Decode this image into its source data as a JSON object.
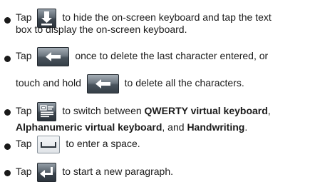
{
  "items": [
    {
      "lines": [
        {
          "pre": "Tap",
          "post": "to hide the on-screen keyboard and tap the text"
        },
        {
          "text": "box to display the on-screen keyboard."
        }
      ],
      "icon": "keyboard-hide-icon"
    },
    {
      "lines": [
        {
          "pre": "Tap",
          "post": "once to delete the last character entered, or"
        },
        {
          "pre": "touch and hold",
          "post": "to delete all the characters."
        }
      ],
      "icon": "backspace-icon"
    },
    {
      "pre": "Tap",
      "post": "to switch between",
      "b1": "QWERTY virtual keyboard",
      "sep1": ",",
      "b2": "Alphanumeric virtual keyboard",
      "sep2": ", and",
      "b3": "Handwriting",
      "end": ".",
      "icon": "input-method-icon"
    },
    {
      "pre": "Tap",
      "post": "to enter a space.",
      "icon": "space-bar-icon"
    },
    {
      "pre": "Tap",
      "post": "to start a new paragraph.",
      "icon": "enter-icon"
    }
  ]
}
